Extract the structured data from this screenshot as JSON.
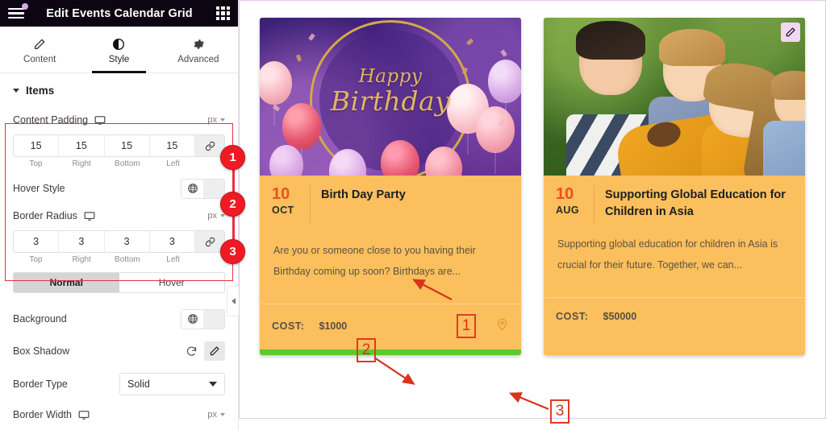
{
  "panel": {
    "title": "Edit Events Calendar Grid",
    "menu_icon": "hamburger-icon",
    "apps_icon": "apps-grid-icon",
    "tabs": [
      {
        "label": "Content",
        "icon": "pencil-icon",
        "active": false
      },
      {
        "label": "Style",
        "icon": "contrast-circle-icon",
        "active": true
      },
      {
        "label": "Advanced",
        "icon": "gear-icon",
        "active": false
      }
    ],
    "section": {
      "label": "Items",
      "expanded": true
    },
    "controls": {
      "content_padding": {
        "label": "Content Padding",
        "device_icon": "desktop-icon",
        "unit": "px",
        "values": [
          "15",
          "15",
          "15",
          "15"
        ],
        "sides": [
          "Top",
          "Right",
          "Bottom",
          "Left"
        ],
        "link_icon": "link-icon"
      },
      "hover_style": {
        "label": "Hover Style",
        "globe_icon": "globe-icon",
        "color": "#5fcc1f"
      },
      "border_radius": {
        "label": "Border Radius",
        "device_icon": "desktop-icon",
        "unit": "px",
        "values": [
          "3",
          "3",
          "3",
          "3"
        ],
        "sides": [
          "Top",
          "Right",
          "Bottom",
          "Left"
        ],
        "link_icon": "link-icon"
      },
      "state_toggle": {
        "normal": "Normal",
        "hover": "Hover",
        "active": "Normal"
      },
      "background": {
        "label": "Background",
        "globe_icon": "globe-icon",
        "color": "#fbc44e"
      },
      "box_shadow": {
        "label": "Box Shadow",
        "reset_icon": "reset-icon",
        "edit_icon": "pencil-icon"
      },
      "border_type": {
        "label": "Border Type",
        "value": "Solid"
      },
      "border_width": {
        "label": "Border Width",
        "device_icon": "desktop-icon",
        "unit": "px"
      }
    },
    "badges": [
      "1",
      "2",
      "3"
    ],
    "collapse_icon": "chevron-left-icon"
  },
  "canvas": {
    "cards": [
      {
        "image_alt": "happy-birthday-balloons",
        "image_text": {
          "line1": "Happy",
          "line2": "Birthday"
        },
        "day": "10",
        "month": "OCT",
        "title": "Birth Day Party",
        "description": "Are you or someone close to you having their Birthday coming up soon? Birthdays are...",
        "cost_label": "COST:",
        "cost_value": "$1000",
        "pin_icon": "location-pin-icon",
        "accent_bar_color": "#5ec92c"
      },
      {
        "image_alt": "children-hugging-outdoors",
        "day": "10",
        "month": "AUG",
        "title": "Supporting Global Education for Children in Asia",
        "description": "Supporting global education for children in Asia is crucial for their future. Together, we can...",
        "cost_label": "COST:",
        "cost_value": "$50000",
        "edit_icon": "pencil-icon"
      }
    ],
    "annotations": [
      {
        "label": "1"
      },
      {
        "label": "2"
      },
      {
        "label": "3"
      }
    ]
  }
}
